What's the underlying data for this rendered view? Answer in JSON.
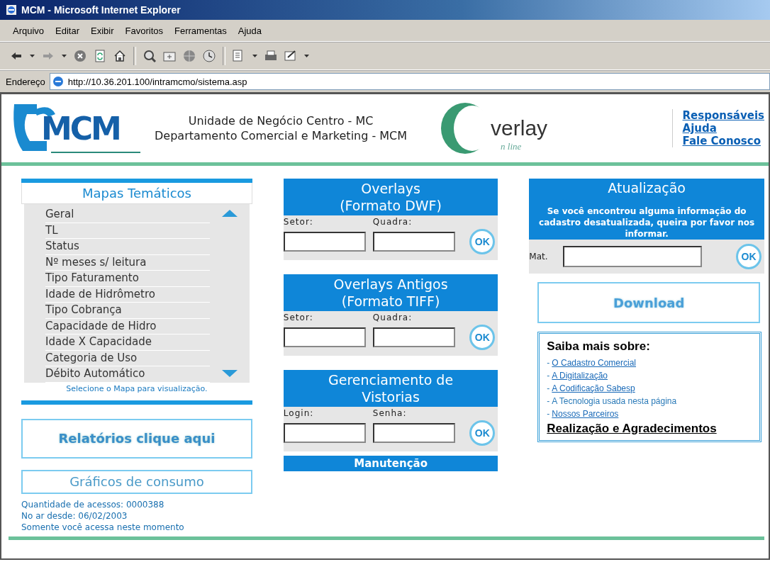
{
  "window": {
    "title": "MCM - Microsoft Internet Explorer"
  },
  "menu": [
    "Arquivo",
    "Editar",
    "Exibir",
    "Favoritos",
    "Ferramentas",
    "Ajuda"
  ],
  "address": {
    "label": "Endereço",
    "url": "http://10.36.201.100/intramcmo/sistema.asp"
  },
  "header": {
    "logo_text": "MCM",
    "lines": [
      "Unidade de Negócio Centro - MC",
      "Departamento Comercial e Marketing - MCM"
    ],
    "overlay_logo": {
      "main": "verlay",
      "sub": "n line"
    },
    "links": [
      "Responsáveis",
      "Ajuda",
      "Fale Conosco"
    ]
  },
  "mapas": {
    "title": "Mapas Temáticos",
    "items": [
      "Geral",
      "TL",
      "Status",
      "Nº meses s/ leitura",
      "Tipo Faturamento",
      "Idade de Hidrômetro",
      "Tipo Cobrança",
      "Capacidade de Hidro",
      "Idade X Capacidade",
      "Categoria de Uso",
      "Débito Automático"
    ],
    "hint": "Selecione o Mapa para visualização."
  },
  "left_buttons": [
    {
      "label": "Relatórios clique aqui",
      "kind": "bold"
    },
    {
      "label": "Gráficos de consumo",
      "kind": "plain"
    }
  ],
  "stats": [
    "Quantidade de acessos: 0000388",
    "No ar desde: 06/02/2003",
    "Somente você acessa neste momento"
  ],
  "forms": [
    {
      "title": [
        "Overlays",
        "(Formato DWF)"
      ],
      "fields": [
        "Setor:",
        "Quadra:"
      ],
      "ok": "OK"
    },
    {
      "title": [
        "Overlays Antigos",
        "(Formato TIFF)"
      ],
      "fields": [
        "Setor:",
        "Quadra:"
      ],
      "ok": "OK"
    },
    {
      "title": [
        "Gerenciamento de",
        "Vistorias"
      ],
      "fields": [
        "Login:",
        "Senha:"
      ],
      "ok": "OK"
    }
  ],
  "maintenance": "Manutenção",
  "atualizacao": {
    "title": "Atualização",
    "message": "Se você encontrou alguma informação do cadastro desatualizada, queira por favor nos informar.",
    "field_label": "Mat.",
    "ok": "OK"
  },
  "download": "Download",
  "saiba": {
    "heading": "Saiba mais sobre:",
    "items": [
      {
        "bullet": "-",
        "text": "O Cadastro Comercial",
        "kind": "link"
      },
      {
        "bullet": "-",
        "text": "A Digitalização",
        "kind": "link"
      },
      {
        "bullet": "-",
        "text": "A Codificação Sabesp",
        "kind": "link"
      },
      {
        "bullet": "-",
        "text": "A Tecnologia usada nesta página",
        "kind": "plain"
      },
      {
        "bullet": "-",
        "text": "Nossos Parceiros",
        "kind": "link"
      }
    ],
    "footer": "Realização e Agradecimentos"
  }
}
